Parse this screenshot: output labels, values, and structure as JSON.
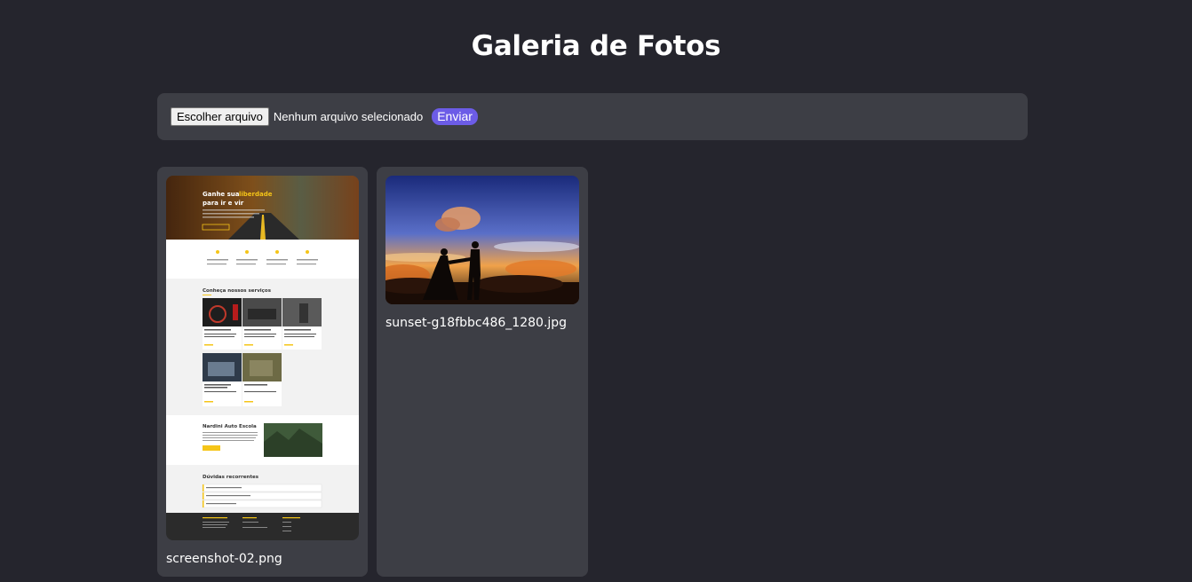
{
  "header": {
    "title": "Galeria de Fotos"
  },
  "upload": {
    "choose_file_label": "Escolher arquivo",
    "file_status": "Nenhum arquivo selecionado",
    "submit_label": "Enviar"
  },
  "gallery": {
    "items": [
      {
        "filename": "screenshot-02.png",
        "thumbnail": {
          "hero_title_line1": "Ganhe sua",
          "hero_title_highlight": "liberdade",
          "hero_title_line2": "para ir e vir",
          "services_heading": "Conheça nossos serviços",
          "about_heading": "Nardini Auto Escola",
          "faq_heading": "Dúvidas recorrentes"
        }
      },
      {
        "filename": "sunset-g18fbbc486_1280.jpg"
      }
    ]
  },
  "colors": {
    "background": "#25252d",
    "panel": "#3d3e45",
    "accent": "#6c5ce7",
    "thumbnail_yellow": "#f5c518"
  }
}
